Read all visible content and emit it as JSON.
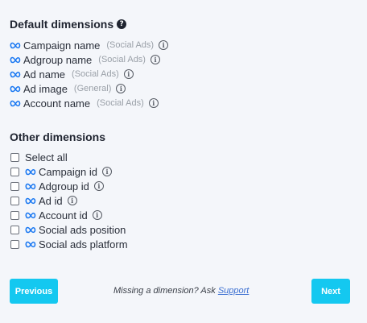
{
  "default_section": {
    "title": "Default dimensions",
    "help_glyph": "?",
    "items": [
      {
        "label": "Campaign name",
        "source": "(Social Ads)",
        "icon": "meta-icon"
      },
      {
        "label": "Adgroup name",
        "source": "(Social Ads)",
        "icon": "meta-icon"
      },
      {
        "label": "Ad name",
        "source": "(Social Ads)",
        "icon": "meta-icon"
      },
      {
        "label": "Ad image",
        "source": "(General)",
        "icon": "meta-icon"
      },
      {
        "label": "Account name",
        "source": "(Social Ads)",
        "icon": "meta-icon"
      }
    ]
  },
  "other_section": {
    "title": "Other dimensions",
    "select_all_label": "Select all",
    "items": [
      {
        "label": "Campaign id",
        "has_info": true
      },
      {
        "label": "Adgroup id",
        "has_info": true
      },
      {
        "label": "Ad id",
        "has_info": true
      },
      {
        "label": "Account id",
        "has_info": true
      },
      {
        "label": "Social ads position",
        "has_info": false
      },
      {
        "label": "Social ads platform",
        "has_info": false
      }
    ]
  },
  "footer": {
    "previous_label": "Previous",
    "next_label": "Next",
    "missing_text": "Missing a dimension? Ask ",
    "support_link": "Support"
  },
  "colors": {
    "accent": "#14c8f0",
    "meta_blue": "#1877f2",
    "background": "#f4f6fa",
    "link": "#3b6fd1"
  }
}
